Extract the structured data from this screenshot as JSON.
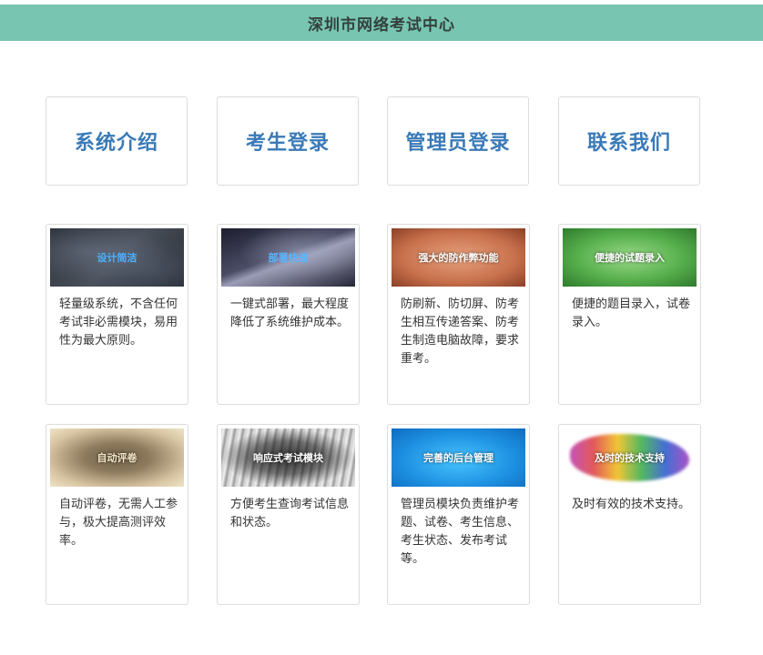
{
  "header": {
    "title": "深圳市网络考试中心"
  },
  "nav": [
    {
      "label": "系统介绍"
    },
    {
      "label": "考生登录"
    },
    {
      "label": "管理员登录"
    },
    {
      "label": "联系我们"
    }
  ],
  "features": [
    {
      "banner": "设计简洁",
      "desc": "轻量级系统，不含任何考试非必需模块，易用性为最大原则。"
    },
    {
      "banner": "部署快速",
      "desc": "一键式部署，最大程度降低了系统维护成本。"
    },
    {
      "banner": "强大的防作弊功能",
      "desc": "防刷新、防切屏、防考生相互传递答案、防考生制造电脑故障，要求重考。"
    },
    {
      "banner": "便捷的试题录入",
      "desc": "便捷的题目录入，试卷录入。"
    },
    {
      "banner": "自动评卷",
      "desc": "自动评卷，无需人工参与，极大提高测评效率。"
    },
    {
      "banner": "响应式考试模块",
      "desc": "方便考生查询考试信息和状态。"
    },
    {
      "banner": "完善的后台管理",
      "desc": "管理员模块负责维护考题、试卷、考生信息、考生状态、发布考试等。"
    },
    {
      "banner": "及时的技术支持",
      "desc": "及时有效的技术支持。"
    }
  ],
  "colors": {
    "header_bg": "#78c5b1",
    "nav_text": "#3a7ab8"
  }
}
